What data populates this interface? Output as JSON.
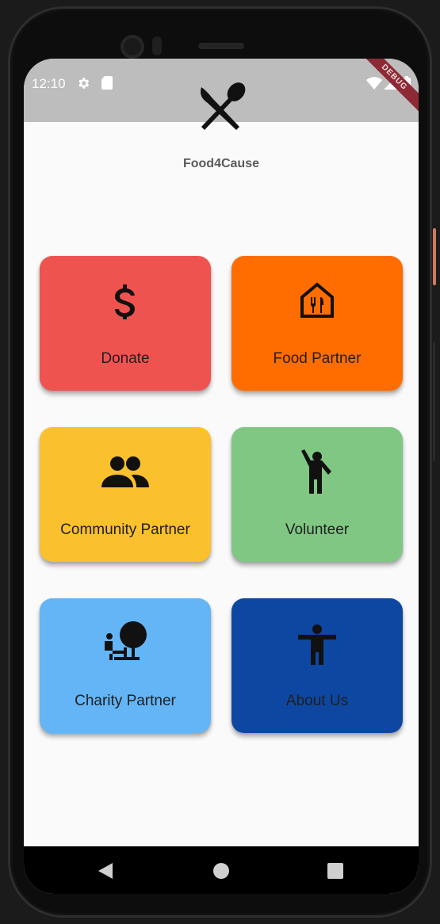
{
  "status_bar": {
    "time": "12:10",
    "left_icons": [
      "gear-icon",
      "sd-card-icon"
    ],
    "right_icons": [
      "wifi-icon",
      "cellular-icon",
      "battery-icon"
    ],
    "debug_banner": "DEBUG",
    "background": "#bdbdbd"
  },
  "app": {
    "logo_icon": "fork-spoon-icon",
    "title": "Food4Cause"
  },
  "tiles": [
    {
      "label": "Donate",
      "icon": "dollar-icon",
      "color": "#ef5350"
    },
    {
      "label": "Food Partner",
      "icon": "food-house-icon",
      "color": "#ff6d00"
    },
    {
      "label": "Community Partner",
      "icon": "people-icon",
      "color": "#fbc02d"
    },
    {
      "label": "Volunteer",
      "icon": "volunteer-hand-raised-icon",
      "color": "#81c784"
    },
    {
      "label": "Charity Partner",
      "icon": "park-bench-icon",
      "color": "#64b5f6"
    },
    {
      "label": "About Us",
      "icon": "accessibility-icon",
      "color": "#0d47a1"
    }
  ],
  "nav_bar": {
    "buttons": [
      "back-icon",
      "home-icon",
      "recents-icon"
    ]
  }
}
